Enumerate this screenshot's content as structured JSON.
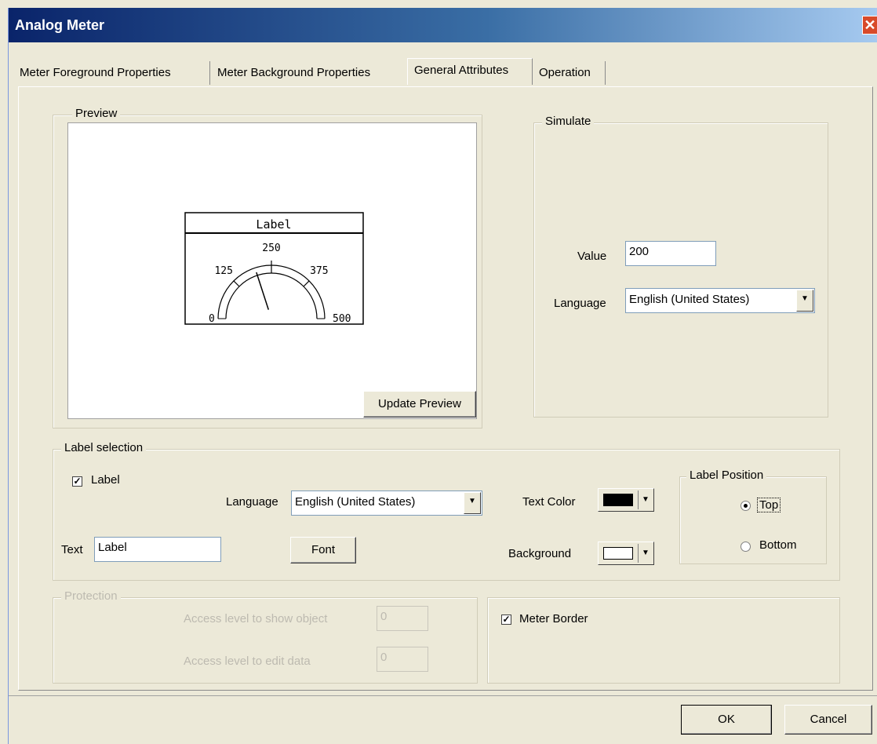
{
  "window": {
    "title": "Analog Meter",
    "close_glyph": "✕"
  },
  "tabs": [
    {
      "label": "Meter Foreground Properties"
    },
    {
      "label": "Meter Background Properties"
    },
    {
      "label": "General Attributes"
    },
    {
      "label": "Operation"
    }
  ],
  "preview": {
    "legend": "Preview",
    "update_button": "Update Preview",
    "meter": {
      "label": "Label",
      "ticks": [
        "0",
        "125",
        "250",
        "375",
        "500"
      ],
      "min": 0,
      "max": 500,
      "value": 200
    }
  },
  "simulate": {
    "legend": "Simulate",
    "value_label": "Value",
    "value": "200",
    "language_label": "Language",
    "language_value": "English (United States)"
  },
  "label_selection": {
    "legend": "Label selection",
    "label_checkbox": "Label",
    "label_checked": true,
    "language_label": "Language",
    "language_value": "English (United States)",
    "text_label": "Text",
    "text_value": "Label",
    "font_button": "Font",
    "text_color_label": "Text Color",
    "text_color": "#000000",
    "background_label": "Background",
    "background_color": "#ffffff",
    "label_position": {
      "legend": "Label Position",
      "top": "Top",
      "bottom": "Bottom",
      "selected": "Top"
    }
  },
  "protection": {
    "legend": "Protection",
    "show_label": "Access level to show object",
    "show_value": "0",
    "edit_label": "Access level to edit data",
    "edit_value": "0"
  },
  "border": {
    "label": "Meter Border",
    "checked": true
  },
  "footer": {
    "ok": "OK",
    "cancel": "Cancel"
  }
}
